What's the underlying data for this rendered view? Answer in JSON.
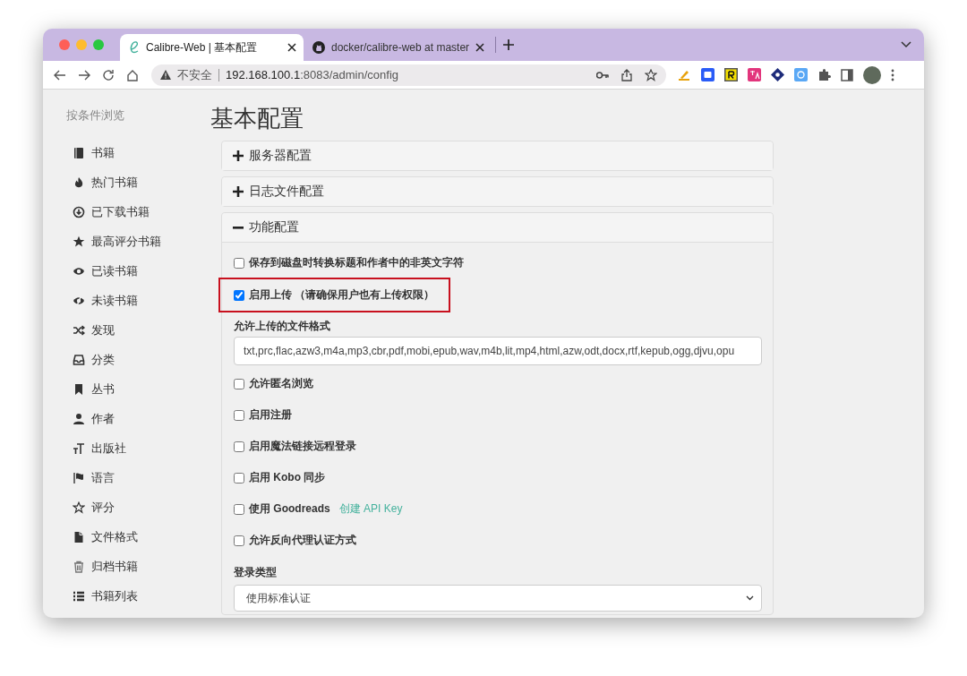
{
  "browser": {
    "tabs": [
      {
        "title": "Calibre-Web | 基本配置",
        "selected": true
      },
      {
        "title": "docker/calibre-web at master",
        "selected": false
      }
    ],
    "address": {
      "security": "不安全",
      "host": "192.168.100.1",
      "path": ":8083/admin/config"
    }
  },
  "sidebar": {
    "heading": "按条件浏览",
    "items": [
      "书籍",
      "热门书籍",
      "已下载书籍",
      "最高评分书籍",
      "已读书籍",
      "未读书籍",
      "发现",
      "分类",
      "丛书",
      "作者",
      "出版社",
      "语言",
      "评分",
      "文件格式",
      "归档书籍",
      "书籍列表"
    ]
  },
  "page_title": "基本配置",
  "panels": [
    {
      "title": "服务器配置",
      "expanded": false
    },
    {
      "title": "日志文件配置",
      "expanded": false
    },
    {
      "title": "功能配置",
      "expanded": true,
      "fields": [
        {
          "kind": "checkbox",
          "label": "保存到磁盘时转换标题和作者中的非英文字符",
          "checked": false,
          "highlighted": false
        },
        {
          "kind": "checkbox",
          "label": "启用上传 （请确保用户也有上传权限）",
          "checked": true,
          "highlighted": true
        },
        {
          "kind": "text",
          "label": "允许上传的文件格式",
          "value": "txt,prc,flac,azw3,m4a,mp3,cbr,pdf,mobi,epub,wav,m4b,lit,mp4,html,azw,odt,docx,rtf,kepub,ogg,djvu,opu"
        },
        {
          "kind": "checkbox",
          "label": "允许匿名浏览",
          "checked": false,
          "highlighted": false
        },
        {
          "kind": "checkbox",
          "label": "启用注册",
          "checked": false,
          "highlighted": false
        },
        {
          "kind": "checkbox",
          "label": "启用魔法链接远程登录",
          "checked": false,
          "highlighted": false
        },
        {
          "kind": "checkbox",
          "label": "启用 Kobo 同步",
          "checked": false,
          "highlighted": false
        },
        {
          "kind": "checkbox",
          "label": "使用 Goodreads",
          "checked": false,
          "highlighted": false,
          "link": "创建 API Key"
        },
        {
          "kind": "checkbox",
          "label": "允许反向代理认证方式",
          "checked": false,
          "highlighted": false
        },
        {
          "kind": "select",
          "label": "登录类型",
          "value": "使用标准认证"
        }
      ]
    }
  ]
}
